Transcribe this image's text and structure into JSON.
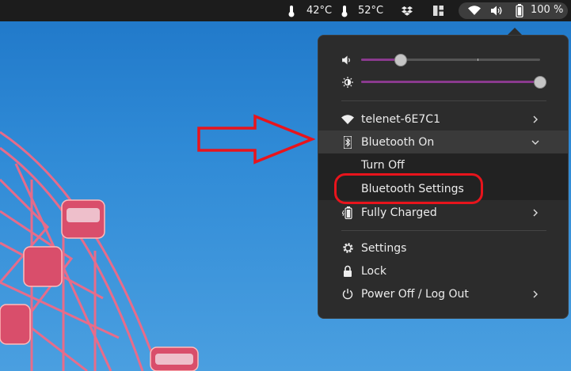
{
  "topbar": {
    "cpu_temp": "42°C",
    "gpu_temp": "52°C",
    "battery_percent": "100 %"
  },
  "menu": {
    "volume_level": 0.22,
    "brightness_level": 1.0,
    "wifi_label": "telenet-6E7C1",
    "bluetooth_label": "Bluetooth On",
    "bluetooth_turn_off": "Turn Off",
    "bluetooth_settings": "Bluetooth Settings",
    "battery_label": "Fully Charged",
    "settings_label": "Settings",
    "lock_label": "Lock",
    "power_label": "Power Off / Log Out"
  },
  "colors": {
    "accent": "#8a3a8e",
    "annotation": "#e8141c"
  }
}
